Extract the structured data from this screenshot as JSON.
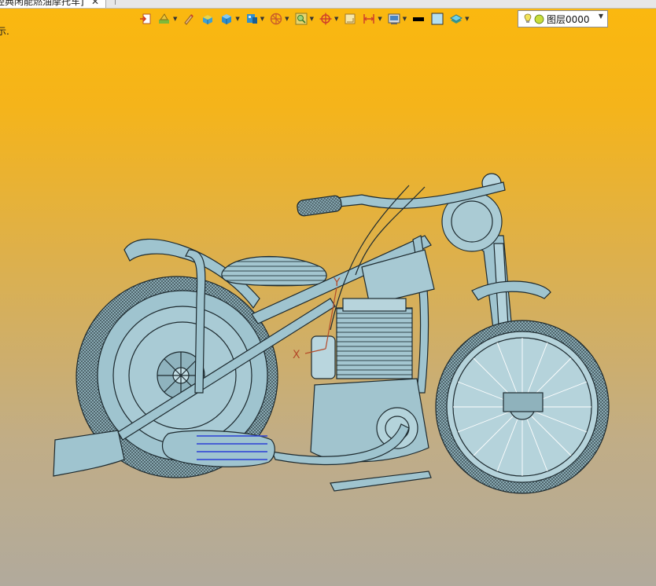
{
  "tab": {
    "title": "经典闲能燃油摩托车]",
    "close_glyph": "✕"
  },
  "status_hint": "示.",
  "toolbar": {
    "items": [
      {
        "name": "exit-sketch-icon",
        "dropdown": false
      },
      {
        "name": "sketch-tools-icon",
        "dropdown": true
      },
      {
        "name": "pencil-icon",
        "dropdown": false
      },
      {
        "name": "shaded-solid-icon",
        "dropdown": false
      },
      {
        "name": "display-mode-icon",
        "dropdown": true
      },
      {
        "name": "view-cube-icon",
        "dropdown": true
      },
      {
        "name": "view-orient-icon",
        "dropdown": true
      },
      {
        "name": "zoom-fit-icon",
        "dropdown": true
      },
      {
        "name": "pan-target-icon",
        "dropdown": true
      },
      {
        "name": "frame-select-icon",
        "dropdown": false
      },
      {
        "name": "dimension-icon",
        "dropdown": true
      },
      {
        "name": "render-settings-icon",
        "dropdown": true
      },
      {
        "name": "line-color-swatch",
        "dropdown": false
      },
      {
        "name": "face-color-swatch",
        "dropdown": false
      },
      {
        "name": "layer-manager-icon",
        "dropdown": true
      }
    ],
    "line_color": "#000000",
    "face_color": "#b4dff0"
  },
  "layer": {
    "name": "图层0000",
    "bulb_color": "#f2e35a",
    "ball_color": "#c8dd3c"
  },
  "viewport": {
    "axis_labels": {
      "x": "X",
      "y": "Y"
    },
    "model_color": "#9fc4cf"
  }
}
